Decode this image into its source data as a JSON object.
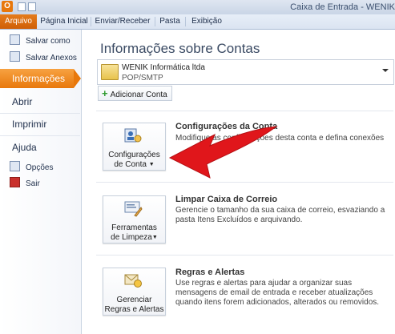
{
  "window": {
    "title": "Caixa de Entrada - WENIK"
  },
  "ribbon": {
    "tabs": [
      {
        "label": "Arquivo"
      },
      {
        "label": "Página Inicial"
      },
      {
        "label": "Enviar/Receber"
      },
      {
        "label": "Pasta"
      },
      {
        "label": "Exibição"
      }
    ]
  },
  "nav": {
    "save_as": "Salvar como",
    "save_attachments": "Salvar Anexos",
    "info": "Informações",
    "open": "Abrir",
    "print": "Imprimir",
    "help": "Ajuda",
    "options": "Opções",
    "exit": "Sair"
  },
  "main": {
    "title": "Informações sobre Contas",
    "account": {
      "name": "WENIK Informática ltda",
      "type": "POP/SMTP"
    },
    "add_account": "Adicionar Conta",
    "sections": [
      {
        "button_line1": "Configurações",
        "button_line2": "de Conta",
        "title": "Configurações da Conta",
        "desc": "Modifique as configurações desta conta e defina conexões"
      },
      {
        "button_line1": "Ferramentas",
        "button_line2": "de Limpeza",
        "title": "Limpar Caixa de Correio",
        "desc": "Gerencie o tamanho da sua caixa de correio, esvaziando a pasta Itens Excluídos e arquivando."
      },
      {
        "button_line1": "Gerenciar",
        "button_line2": "Regras e Alertas",
        "title": "Regras e Alertas",
        "desc": "Use regras e alertas para ajudar a organizar suas mensagens de email de entrada e receber atualizações quando itens forem adicionados, alterados ou removidos."
      }
    ]
  },
  "colors": {
    "accent": "#e8780c",
    "arrow": "#e0161b"
  }
}
